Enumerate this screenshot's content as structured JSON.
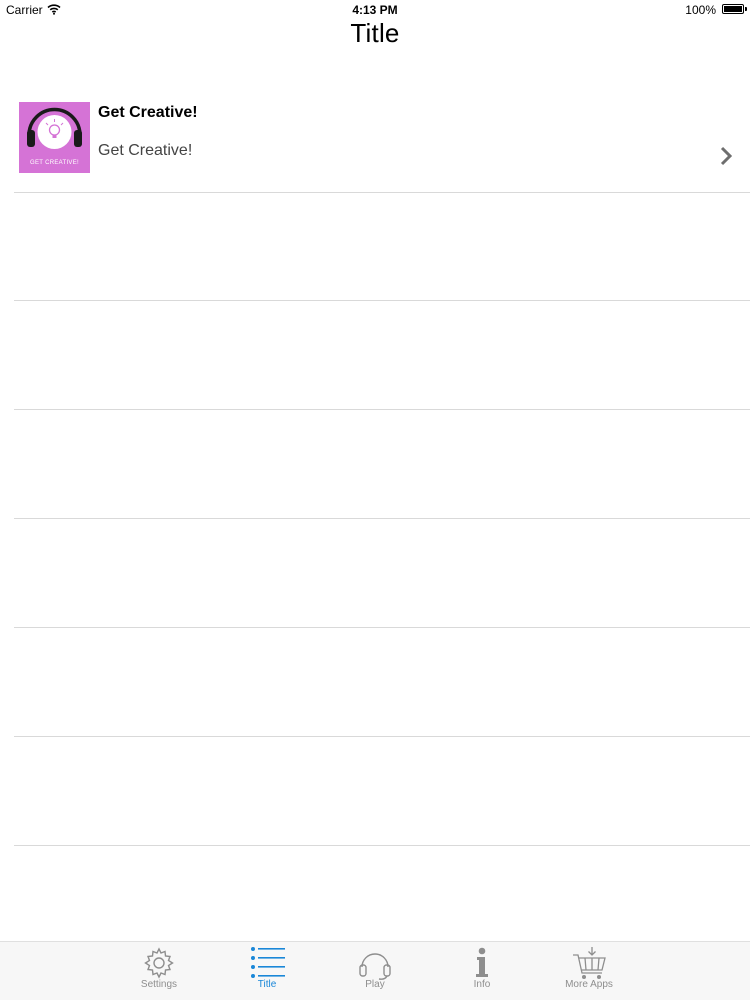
{
  "status_bar": {
    "carrier": "Carrier",
    "time": "4:13 PM",
    "battery": "100%"
  },
  "nav": {
    "title": "Title"
  },
  "list": {
    "items": [
      {
        "title": "Get Creative!",
        "subtitle": "Get Creative!",
        "thumbnail_text": "GET CREATIVE!",
        "thumbnail_icon": "headphones-lightbulb-icon",
        "accessory": "chevron-right-icon"
      }
    ],
    "empty_rows": 6
  },
  "tab_bar": {
    "tabs": [
      {
        "label": "Settings",
        "icon": "gear-icon",
        "active": false
      },
      {
        "label": "Title",
        "icon": "list-icon",
        "active": true
      },
      {
        "label": "Play",
        "icon": "headphones-icon",
        "active": false
      },
      {
        "label": "Info",
        "icon": "info-icon",
        "active": false
      },
      {
        "label": "More Apps",
        "icon": "cart-icon",
        "active": false
      }
    ]
  },
  "colors": {
    "accent": "#1a87d8",
    "thumbnail_bg": "#d573d6",
    "separator": "#d9d9d9",
    "tab_inactive": "#8e8e8e"
  }
}
